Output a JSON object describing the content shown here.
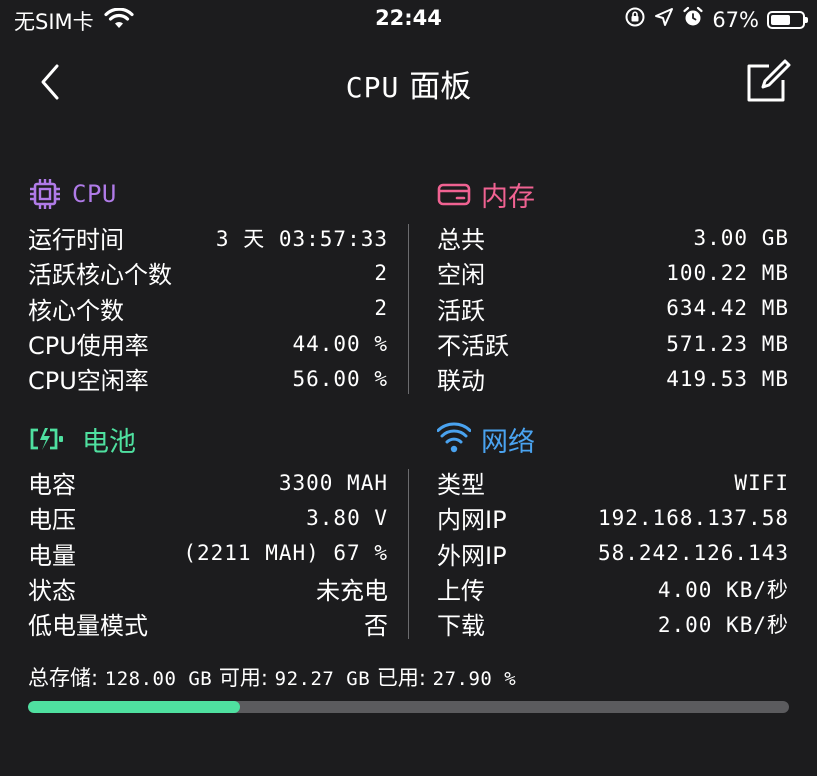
{
  "statusbar": {
    "carrier": "无SIM卡",
    "time": "22:44",
    "battery_percent": "67%",
    "battery_level": 0.67,
    "icons": [
      "wifi-icon",
      "screen-rotation-lock-icon",
      "location-icon",
      "alarm-icon",
      "battery-icon"
    ]
  },
  "nav": {
    "title_prefix": "CPU",
    "title_suffix": " 面板",
    "back_icon": "chevron-left-icon",
    "edit_icon": "edit-icon"
  },
  "colors": {
    "cpu": "#b07be8",
    "memory": "#f06292",
    "battery": "#4fe0a0",
    "network": "#4aa3f0",
    "progress_track": "#5b5b5e",
    "background": "#1c1c1e"
  },
  "cpu": {
    "title": "CPU",
    "icon": "cpu-chip-icon",
    "rows": [
      {
        "label": "运行时间",
        "value": "3 天 03:57:33"
      },
      {
        "label": "活跃核心个数",
        "value": "2"
      },
      {
        "label": "核心个数",
        "value": "2"
      },
      {
        "label": "CPU使用率",
        "value": "44.00 %"
      },
      {
        "label": "CPU空闲率",
        "value": "56.00 %"
      }
    ]
  },
  "memory": {
    "title": "内存",
    "icon": "memory-card-icon",
    "rows": [
      {
        "label": "总共",
        "value": "3.00 GB"
      },
      {
        "label": "空闲",
        "value": "100.22 MB"
      },
      {
        "label": "活跃",
        "value": "634.42 MB"
      },
      {
        "label": "不活跃",
        "value": "571.23 MB"
      },
      {
        "label": "联动",
        "value": "419.53 MB"
      }
    ]
  },
  "battery": {
    "title": "电池",
    "icon": "battery-charging-icon",
    "rows": [
      {
        "label": "电容",
        "value": "3300 MAH"
      },
      {
        "label": "电压",
        "value": "3.80 V"
      },
      {
        "label": "电量",
        "value": "(2211 MAH) 67 %"
      },
      {
        "label": "状态",
        "value": "未充电"
      },
      {
        "label": "低电量模式",
        "value": "否"
      }
    ]
  },
  "network": {
    "title": "网络",
    "icon": "wifi-icon",
    "rows": [
      {
        "label": "类型",
        "value": "WIFI"
      },
      {
        "label": "内网IP",
        "value": "192.168.137.58"
      },
      {
        "label": "外网IP",
        "value": "58.242.126.143"
      },
      {
        "label": "上传",
        "value": "4.00 KB/秒"
      },
      {
        "label": "下载",
        "value": "2.00 KB/秒"
      }
    ]
  },
  "storage": {
    "total_label": "总存储:",
    "total_value": "128.00 GB",
    "available_label": "可用:",
    "available_value": "92.27 GB",
    "used_label": "已用:",
    "used_value": "27.90 %",
    "used_fraction": 0.279
  }
}
